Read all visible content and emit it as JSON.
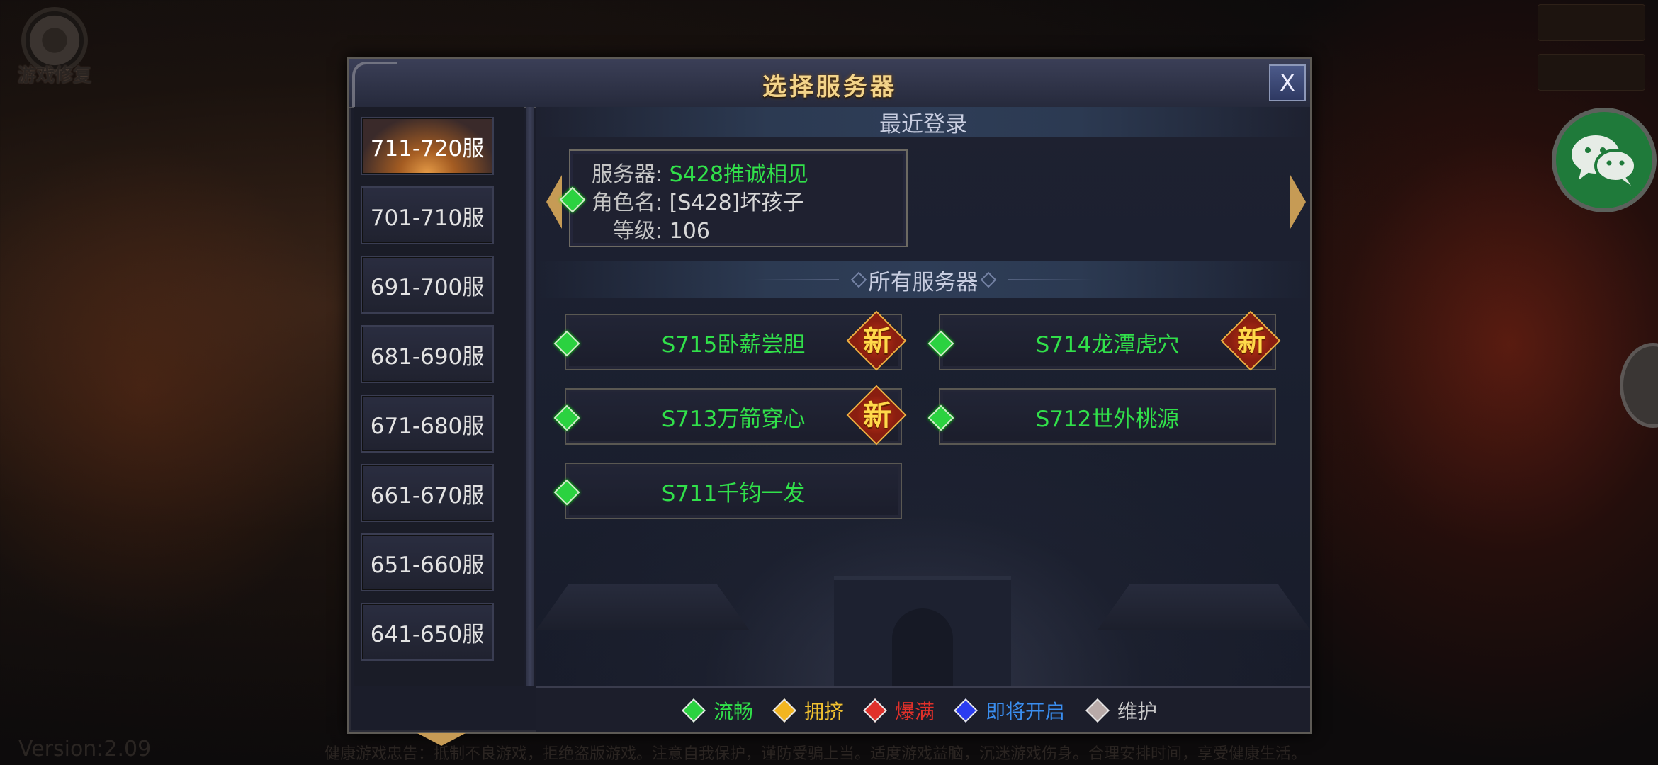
{
  "app": {
    "version": "Version:2.09",
    "health_notice": "健康游戏忠告：抵制不良游戏，拒绝盗版游戏。注意自我保护，谨防受骗上当。适度游戏益脑，沉迷游戏伤身。合理安排时间，享受健康生活。"
  },
  "repair": {
    "label": "游戏修复",
    "icon": "gear-icon"
  },
  "dialog": {
    "title": "选择服务器",
    "close_label": "X"
  },
  "groups": [
    {
      "label": "711-720服",
      "active": true
    },
    {
      "label": "701-710服",
      "active": false
    },
    {
      "label": "691-700服",
      "active": false
    },
    {
      "label": "681-690服",
      "active": false
    },
    {
      "label": "671-680服",
      "active": false
    },
    {
      "label": "661-670服",
      "active": false
    },
    {
      "label": "651-660服",
      "active": false
    },
    {
      "label": "641-650服",
      "active": false
    }
  ],
  "recent": {
    "heading": "最近登录",
    "server_label": "服务器:",
    "server_value": "S428推诚相见",
    "role_label": "角色名:",
    "role_value": "[S428]坏孩子",
    "level_label": "等级:",
    "level_value": "106"
  },
  "all_servers": {
    "heading": "所有服务器",
    "new_badge": "新",
    "servers": [
      {
        "name": "S715卧薪尝胆",
        "is_new": true,
        "status": "流畅"
      },
      {
        "name": "S714龙潭虎穴",
        "is_new": true,
        "status": "流畅"
      },
      {
        "name": "S713万箭穿心",
        "is_new": true,
        "status": "流畅"
      },
      {
        "name": "S712世外桃源",
        "is_new": false,
        "status": "流畅"
      },
      {
        "name": "S711千钧一发",
        "is_new": false,
        "status": "流畅"
      }
    ]
  },
  "legend": [
    {
      "label": "流畅",
      "color": "#2bd240"
    },
    {
      "label": "拥挤",
      "color": "#f2b520"
    },
    {
      "label": "爆满",
      "color": "#e0302a"
    },
    {
      "label": "即将开启",
      "color": "#2a3cf0"
    },
    {
      "label": "维护",
      "color": "#b8aaa8"
    }
  ]
}
